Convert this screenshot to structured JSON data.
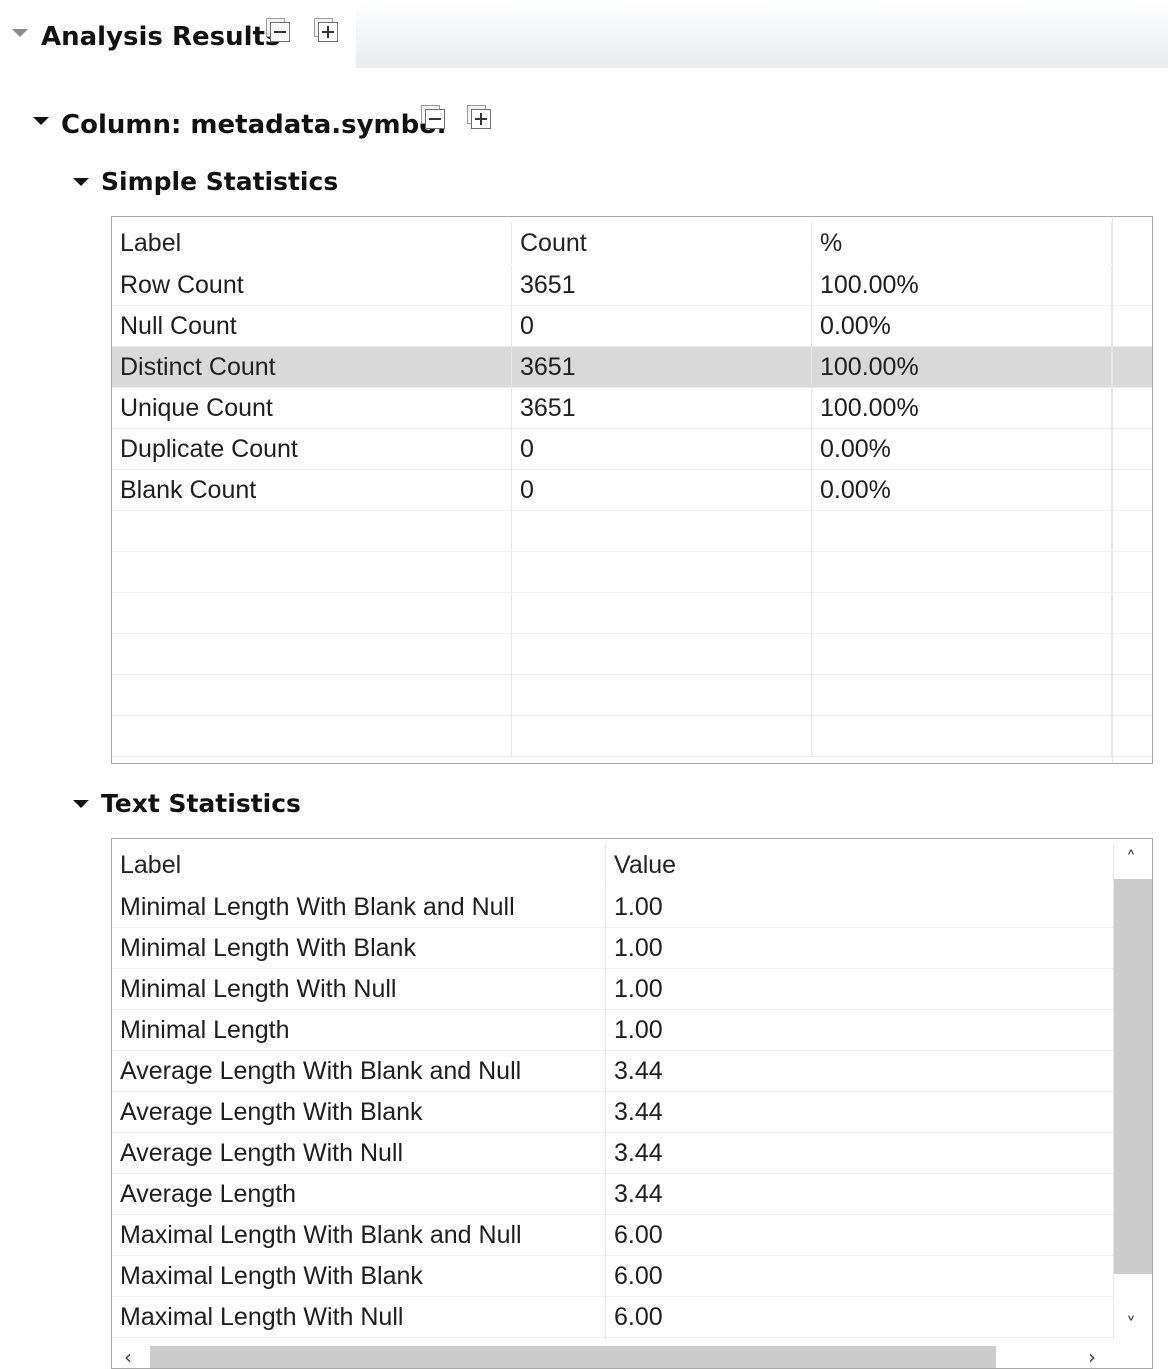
{
  "header": {
    "title": "Analysis Results"
  },
  "column_section": {
    "title": "Column: metadata.symbol"
  },
  "simple_statistics": {
    "title": "Simple Statistics",
    "columns": [
      "Label",
      "Count",
      "%"
    ],
    "rows": [
      [
        "Row Count",
        "3651",
        "100.00%"
      ],
      [
        "Null Count",
        "0",
        "0.00%"
      ],
      [
        "Distinct Count",
        "3651",
        "100.00%"
      ],
      [
        "Unique Count",
        "3651",
        "100.00%"
      ],
      [
        "Duplicate Count",
        "0",
        "0.00%"
      ],
      [
        "Blank Count",
        "0",
        "0.00%"
      ]
    ],
    "selected_row_index": 2
  },
  "text_statistics": {
    "title": "Text Statistics",
    "columns": [
      "Label",
      "Value"
    ],
    "rows": [
      [
        "Minimal Length With Blank and Null",
        "1.00"
      ],
      [
        "Minimal Length With Blank",
        "1.00"
      ],
      [
        "Minimal Length With Null",
        "1.00"
      ],
      [
        "Minimal Length",
        "1.00"
      ],
      [
        "Average Length With Blank and Null",
        "3.44"
      ],
      [
        "Average Length With Blank",
        "3.44"
      ],
      [
        "Average Length With Null",
        "3.44"
      ],
      [
        "Average Length",
        "3.44"
      ],
      [
        "Maximal Length With Blank and Null",
        "6.00"
      ],
      [
        "Maximal Length With Blank",
        "6.00"
      ],
      [
        "Maximal Length With Null",
        "6.00"
      ]
    ]
  },
  "icons": {
    "collapse": "collapse-all-icon",
    "expand": "expand-all-icon",
    "scroll_up": "˄",
    "scroll_down": "˅",
    "scroll_left": "‹",
    "scroll_right": "›"
  },
  "colors": {
    "selected_row": "#d9d9d9",
    "scroll_thumb": "#cdcdcd"
  }
}
